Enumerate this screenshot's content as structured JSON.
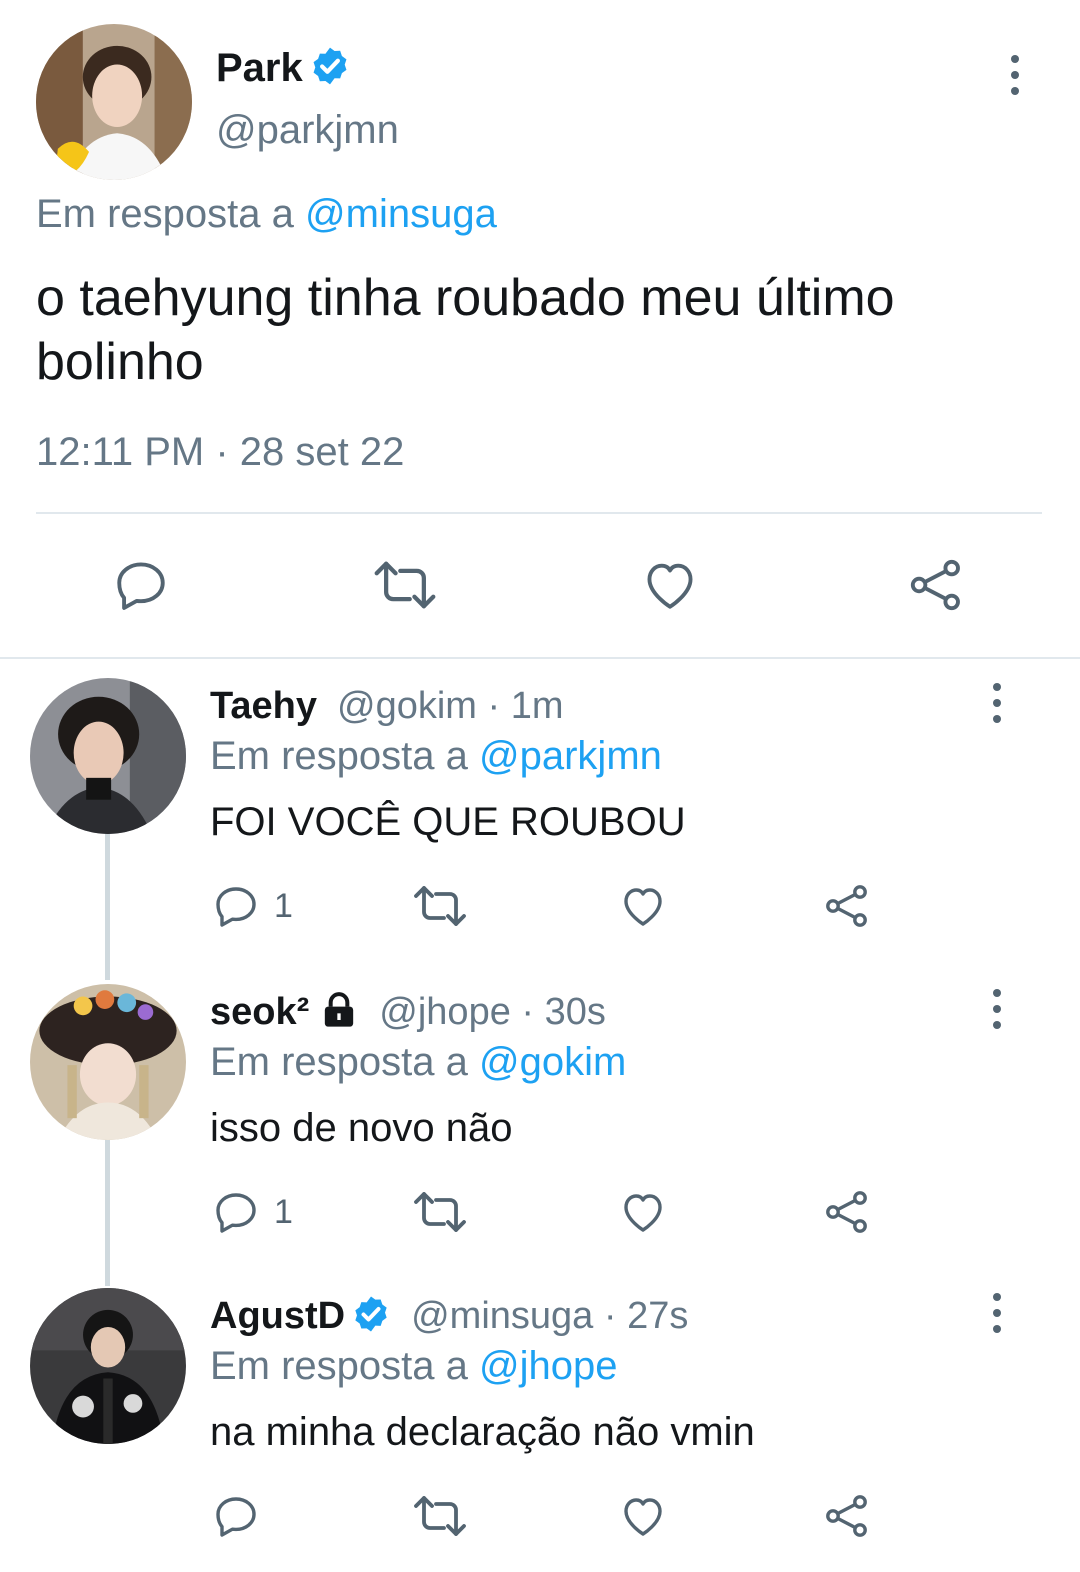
{
  "main_tweet": {
    "name": "Park",
    "verified": true,
    "handle": "@parkjmn",
    "replying_prefix": "Em resposta a",
    "replying_to": "@minsuga",
    "text": "o taehyung tinha roubado meu último bolinho",
    "timestamp": "12:11 PM · 28 set 22",
    "more_icon": "more-vertical-icon",
    "actions": [
      "reply-icon",
      "retweet-icon",
      "like-icon",
      "share-icon"
    ]
  },
  "replies": [
    {
      "name": "Taehy",
      "handle_time": "@gokim · 1m",
      "replying_prefix": "Em resposta a",
      "replying_to": "@parkjmn",
      "text": "FOI VOCÊ QUE ROUBOU",
      "reply_count": "1"
    },
    {
      "name": "seok²",
      "locked": true,
      "handle_time": "@jhope · 30s",
      "replying_prefix": "Em resposta a",
      "replying_to": "@gokim",
      "text": "isso de novo não",
      "reply_count": "1"
    },
    {
      "name": "AgustD",
      "verified": true,
      "handle_time": "@minsuga · 27s",
      "replying_prefix": "Em resposta a",
      "replying_to": "@jhope",
      "text": "na minha declaração não vmin",
      "reply_count": ""
    }
  ],
  "colors": {
    "primary_text": "#14171a",
    "secondary_text": "#657786",
    "link": "#1da1f2",
    "icon": "#536471",
    "divider": "#e1e8ed",
    "thread_line": "#cfd9de"
  }
}
